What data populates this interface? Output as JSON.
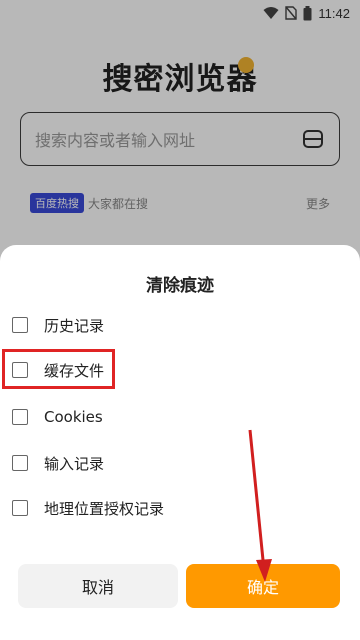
{
  "status_bar": {
    "time": "11:42"
  },
  "app": {
    "title": "搜密浏览器"
  },
  "search": {
    "placeholder": "搜索内容或者输入网址"
  },
  "hot": {
    "badge": "百度热搜",
    "text": "大家都在搜",
    "more": "更多"
  },
  "dialog": {
    "title": "清除痕迹",
    "options": [
      {
        "label": "历史记录",
        "checked": false
      },
      {
        "label": "缓存文件",
        "checked": false
      },
      {
        "label": "Cookies",
        "checked": false
      },
      {
        "label": "输入记录",
        "checked": false
      },
      {
        "label": "地理位置授权记录",
        "checked": false
      }
    ],
    "cancel_label": "取消",
    "confirm_label": "确定"
  },
  "colors": {
    "accent": "#ff9900",
    "annotation": "#e02424",
    "badge": "#3a4ad9"
  }
}
